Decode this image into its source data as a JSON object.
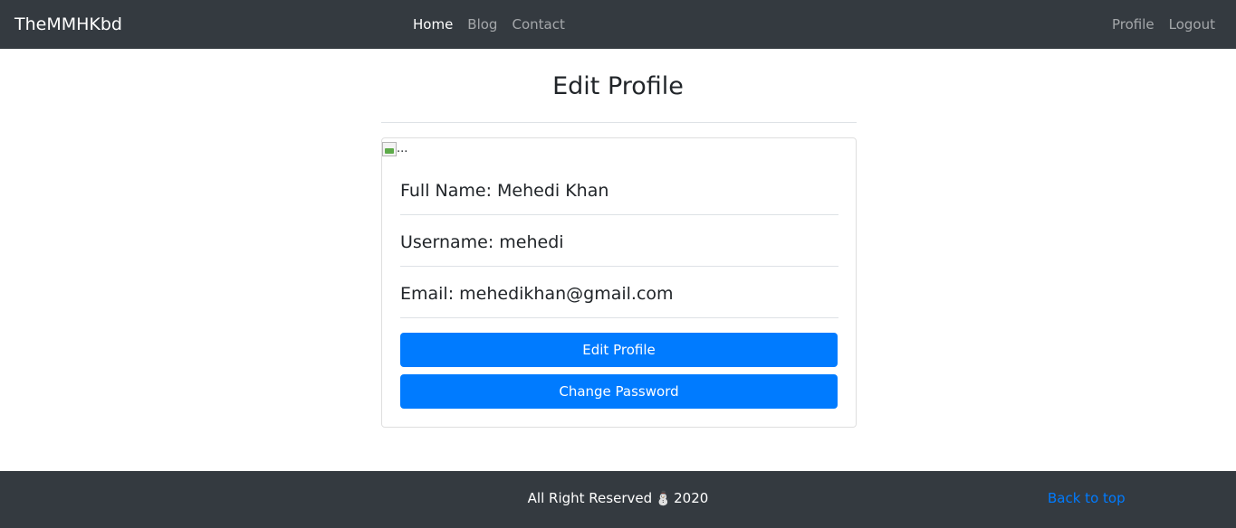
{
  "navbar": {
    "brand": "TheMMHKbd",
    "left_links": [
      {
        "label": "Home",
        "active": true
      },
      {
        "label": "Blog",
        "active": false
      },
      {
        "label": "Contact",
        "active": false
      }
    ],
    "right_links": [
      {
        "label": "Profile"
      },
      {
        "label": "Logout"
      }
    ]
  },
  "main": {
    "title": "Edit Profile",
    "card": {
      "image_alt": "...",
      "full_name_line": "Full Name: Mehedi Khan",
      "username_line": "Username: mehedi",
      "email_line": "Email: mehedikhan@gmail.com",
      "edit_button": "Edit Profile",
      "change_password_button": "Change Password"
    }
  },
  "footer": {
    "text_before": "All Right Reserved",
    "emoji": "⛄",
    "year": "2020",
    "back_to_top": "Back to top"
  },
  "colors": {
    "navbar_bg": "#343a40",
    "primary": "#007bff",
    "footer_bg": "#343a40"
  }
}
